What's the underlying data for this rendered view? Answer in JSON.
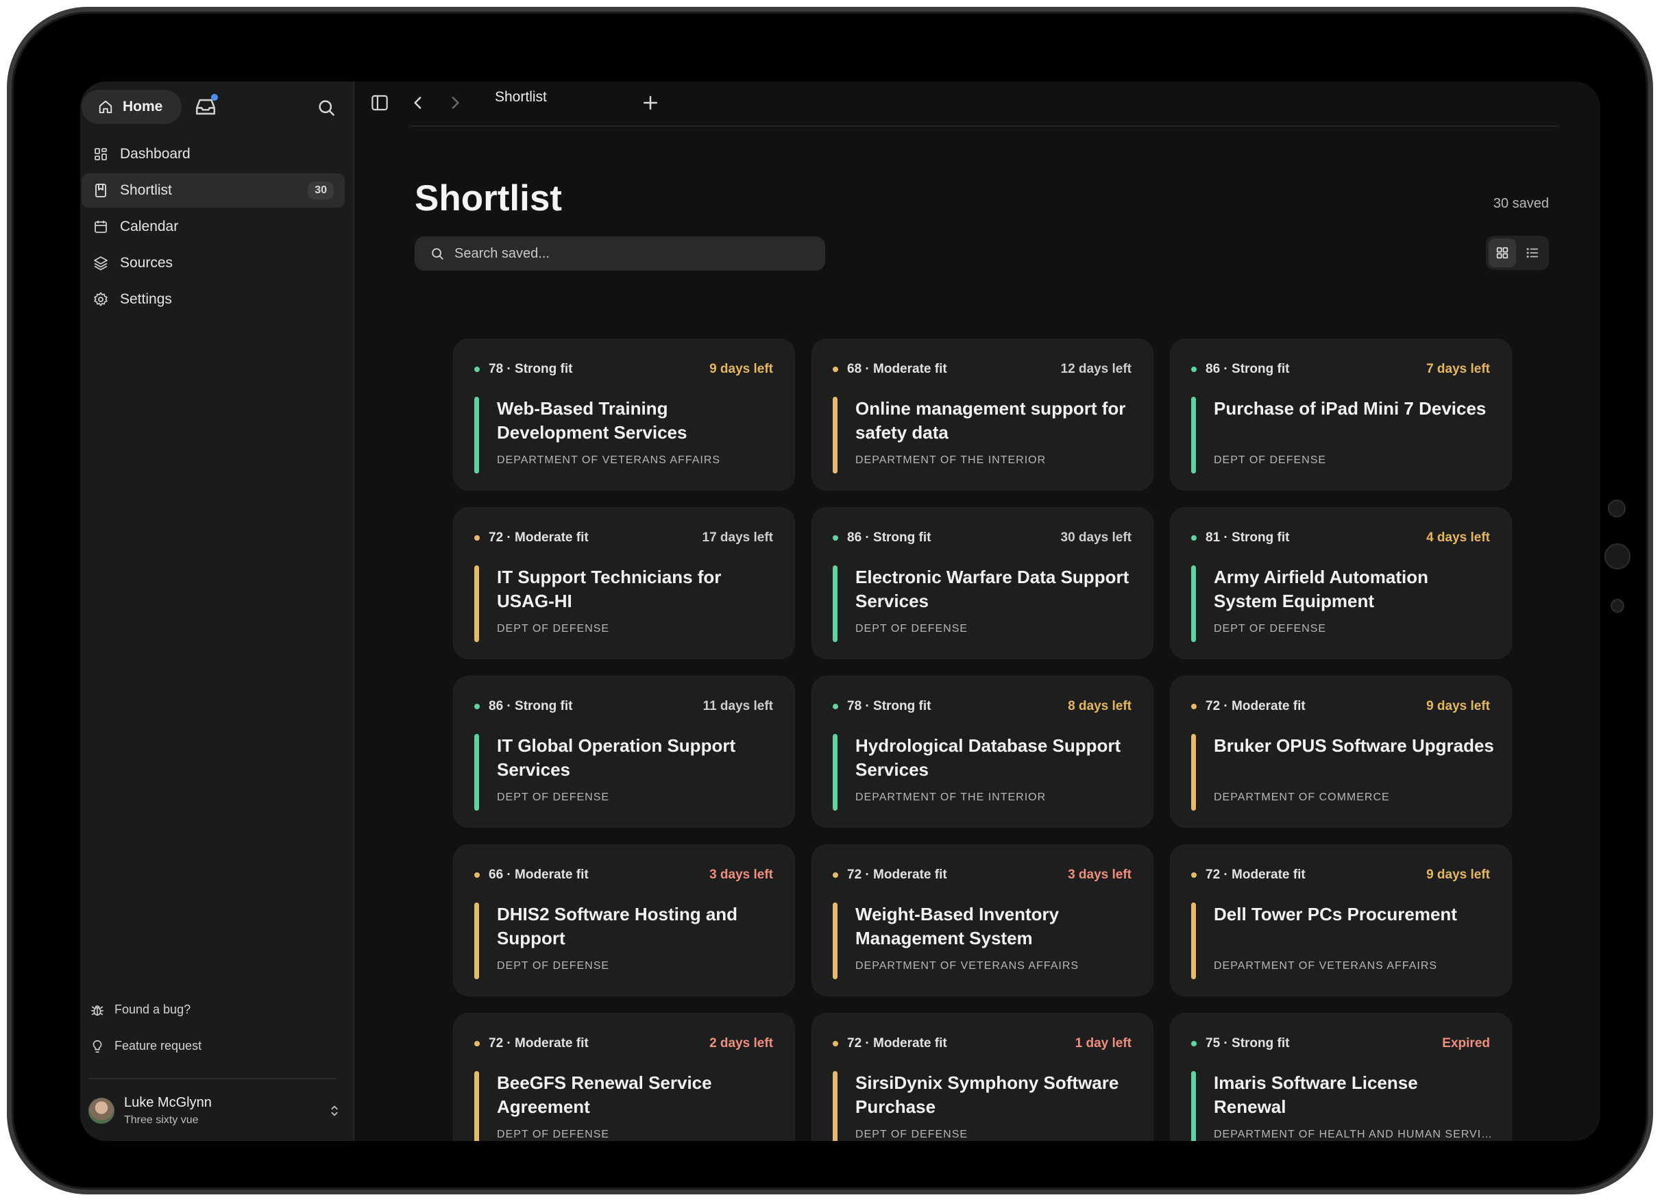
{
  "sidebar": {
    "home_label": "Home",
    "nav": [
      {
        "label": "Dashboard",
        "icon": "dashboard-icon"
      },
      {
        "label": "Shortlist",
        "icon": "bookmark-icon",
        "badge": "30",
        "active": true
      },
      {
        "label": "Calendar",
        "icon": "calendar-icon"
      },
      {
        "label": "Sources",
        "icon": "layers-icon"
      },
      {
        "label": "Settings",
        "icon": "gear-icon"
      }
    ],
    "footer_links": [
      {
        "label": "Found a bug?",
        "icon": "bug-icon"
      },
      {
        "label": "Feature request",
        "icon": "lightbulb-icon"
      }
    ],
    "user": {
      "name": "Luke McGlynn",
      "org": "Three sixty vue"
    }
  },
  "topbar": {
    "tab_title": "Shortlist"
  },
  "main": {
    "title": "Shortlist",
    "saved_count": "30 saved",
    "search_placeholder": "Search saved...",
    "view_modes": [
      "grid",
      "list"
    ],
    "active_view": "grid"
  },
  "colors": {
    "strong": "#5fd3a0",
    "moderate": "#e9b96a",
    "days_warn": "#e6b85c",
    "days_urgent": "#ef8f7d",
    "days_neutral": "#cfcfcf"
  },
  "cards": [
    {
      "score": "78 · Strong fit",
      "fit": "strong",
      "days": "9 days left",
      "urgency": "warn",
      "title": "Web-Based Training Development Services",
      "agency": "DEPARTMENT OF VETERANS AFFAIRS"
    },
    {
      "score": "68 · Moderate fit",
      "fit": "moderate",
      "days": "12 days left",
      "urgency": "neutral",
      "title": "Online management support for safety data",
      "agency": "DEPARTMENT OF THE INTERIOR"
    },
    {
      "score": "86 · Strong fit",
      "fit": "strong",
      "days": "7 days left",
      "urgency": "warn",
      "title": "Purchase of iPad Mini 7 Devices",
      "agency": "DEPT OF DEFENSE"
    },
    {
      "score": "72 · Moderate fit",
      "fit": "moderate",
      "days": "17 days left",
      "urgency": "neutral",
      "title": "IT Support Technicians for USAG-HI",
      "agency": "DEPT OF DEFENSE"
    },
    {
      "score": "86 · Strong fit",
      "fit": "strong",
      "days": "30 days left",
      "urgency": "neutral",
      "title": "Electronic Warfare Data Support Services",
      "agency": "DEPT OF DEFENSE"
    },
    {
      "score": "81 · Strong fit",
      "fit": "strong",
      "days": "4 days left",
      "urgency": "warn",
      "title": "Army Airfield Automation System Equipment",
      "agency": "DEPT OF DEFENSE"
    },
    {
      "score": "86 · Strong fit",
      "fit": "strong",
      "days": "11 days left",
      "urgency": "neutral",
      "title": "IT Global Operation Support Services",
      "agency": "DEPT OF DEFENSE"
    },
    {
      "score": "78 · Strong fit",
      "fit": "strong",
      "days": "8 days left",
      "urgency": "warn",
      "title": "Hydrological Database Support Services",
      "agency": "DEPARTMENT OF THE INTERIOR"
    },
    {
      "score": "72 · Moderate fit",
      "fit": "moderate",
      "days": "9 days left",
      "urgency": "warn",
      "title": "Bruker OPUS Software Upgrades",
      "agency": "DEPARTMENT OF COMMERCE"
    },
    {
      "score": "66 · Moderate fit",
      "fit": "moderate",
      "days": "3 days left",
      "urgency": "urgent",
      "title": "DHIS2 Software Hosting and Support",
      "agency": "DEPT OF DEFENSE"
    },
    {
      "score": "72 · Moderate fit",
      "fit": "moderate",
      "days": "3 days left",
      "urgency": "urgent",
      "title": "Weight-Based Inventory Management System",
      "agency": "DEPARTMENT OF VETERANS AFFAIRS"
    },
    {
      "score": "72 · Moderate fit",
      "fit": "moderate",
      "days": "9 days left",
      "urgency": "warn",
      "title": "Dell Tower PCs Procurement",
      "agency": "DEPARTMENT OF VETERANS AFFAIRS"
    },
    {
      "score": "72 · Moderate fit",
      "fit": "moderate",
      "days": "2 days left",
      "urgency": "urgent",
      "title": "BeeGFS Renewal Service Agreement",
      "agency": "DEPT OF DEFENSE"
    },
    {
      "score": "72 · Moderate fit",
      "fit": "moderate",
      "days": "1 day left",
      "urgency": "urgent",
      "title": "SirsiDynix Symphony Software Purchase",
      "agency": "DEPT OF DEFENSE"
    },
    {
      "score": "75 · Strong fit",
      "fit": "strong",
      "days": "Expired",
      "urgency": "urgent",
      "title": "Imaris Software License Renewal",
      "agency": "DEPARTMENT OF HEALTH AND HUMAN SERVICES"
    }
  ]
}
